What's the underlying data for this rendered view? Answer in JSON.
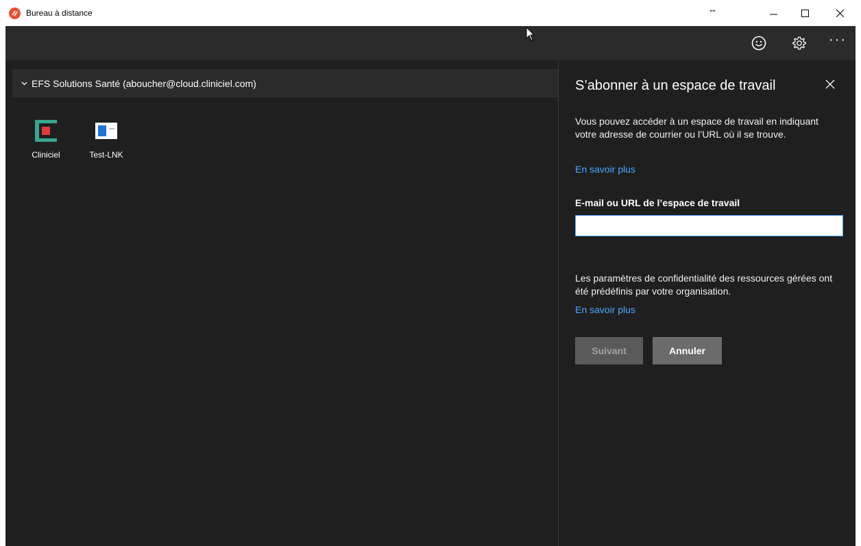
{
  "window": {
    "title": "Bureau à distance",
    "brand_color": "#e8502f"
  },
  "toolbar": {
    "icons": [
      "smiley-icon",
      "gear-icon",
      "more-icon"
    ],
    "more_label": "···"
  },
  "workspace": {
    "group_title": "EFS Solutions Santé (aboucher@cloud.cliniciel.com)",
    "apps": [
      {
        "label": "Cliniciel"
      },
      {
        "label": "Test-LNK"
      }
    ]
  },
  "subscribe_panel": {
    "title": "S’abonner à un espace de travail",
    "description": "Vous pouvez accéder à un espace de travail en indiquant votre adresse de courrier ou l’URL où il se trouve.",
    "learn_more_1": "En savoir plus",
    "field_label": "E-mail ou URL de l’espace de travail",
    "field_value": "",
    "field_placeholder": "",
    "privacy_text": "Les paramètres de confidentialité des ressources gérées ont été prédéfinis par votre organisation.",
    "learn_more_2": "En savoir plus",
    "next_label": "Suivant",
    "cancel_label": "Annuler",
    "link_color": "#4aa7ff"
  }
}
